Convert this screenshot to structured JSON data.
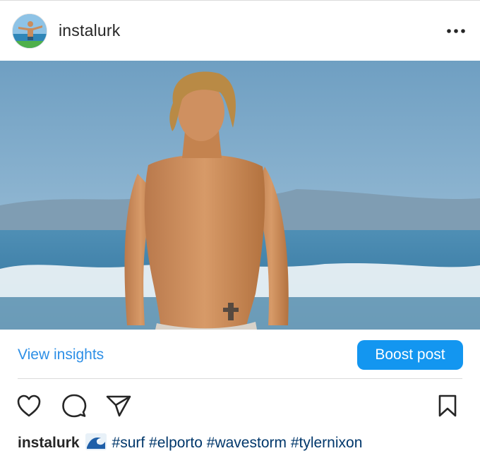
{
  "post": {
    "username": "instalurk",
    "more_icon": "ellipsis-icon",
    "photo_alt": "Shirtless surfer walking out of the ocean at the beach"
  },
  "insights": {
    "view_label": "View insights",
    "boost_label": "Boost post"
  },
  "actions": {
    "like": "heart-icon",
    "comment": "comment-icon",
    "share": "send-icon",
    "save": "bookmark-icon"
  },
  "caption": {
    "username": "instalurk",
    "emoji": "wave-emoji",
    "hashtags": "#surf #elporto #wavestorm #tylernixon"
  },
  "colors": {
    "accent": "#1396f0",
    "link": "#2d8fe6",
    "hashtag": "#00376b"
  }
}
